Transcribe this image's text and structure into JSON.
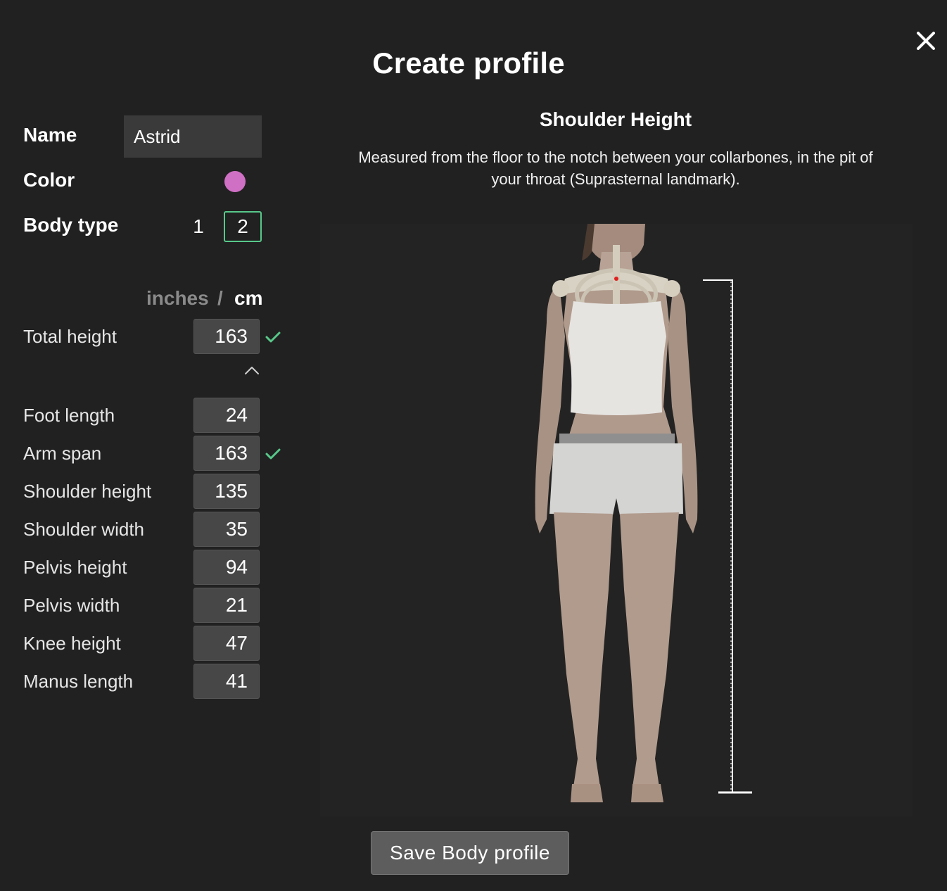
{
  "dialog": {
    "title": "Create profile",
    "close_icon": "close-icon"
  },
  "profile": {
    "name_label": "Name",
    "name_value": "Astrid",
    "color_label": "Color",
    "color_value": "#d070c4",
    "body_type_label": "Body type",
    "body_type_options": [
      "1",
      "2"
    ],
    "body_type_selected": "2"
  },
  "units": {
    "inches": "inches",
    "separator": "/",
    "cm": "cm",
    "selected": "cm"
  },
  "measurements": {
    "total_height": {
      "label": "Total height",
      "value": "163",
      "verified": true
    },
    "items": [
      {
        "label": "Foot length",
        "value": "24",
        "verified": false
      },
      {
        "label": "Arm span",
        "value": "163",
        "verified": true
      },
      {
        "label": "Shoulder height",
        "value": "135",
        "verified": false
      },
      {
        "label": "Shoulder width",
        "value": "35",
        "verified": false
      },
      {
        "label": "Pelvis height",
        "value": "94",
        "verified": false
      },
      {
        "label": "Pelvis width",
        "value": "21",
        "verified": false
      },
      {
        "label": "Knee height",
        "value": "47",
        "verified": false
      },
      {
        "label": "Manus length",
        "value": "41",
        "verified": false
      }
    ]
  },
  "info": {
    "title": "Shoulder Height",
    "description": "Measured from the floor to the notch between your collarbones, in the pit of your throat (Suprasternal landmark)."
  },
  "save_button": "Save Body profile",
  "colors": {
    "accent_green": "#58c88a",
    "landmark_red": "#e02020",
    "background": "#212121"
  }
}
